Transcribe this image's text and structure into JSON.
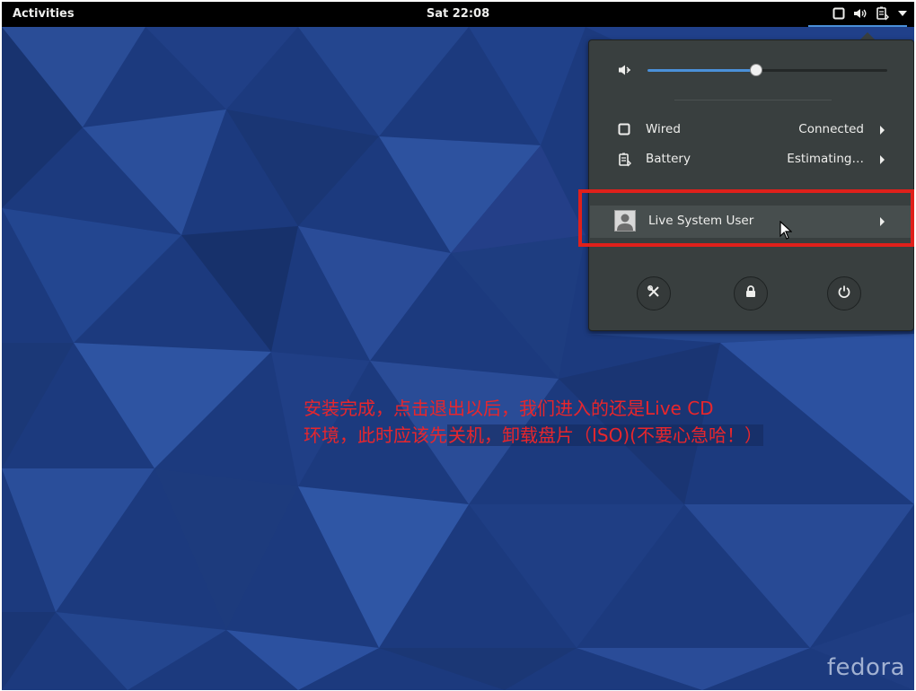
{
  "topbar": {
    "activities": "Activities",
    "clock": "Sat 22:08",
    "tray_icons": [
      "network-wired-icon",
      "speaker-icon",
      "battery-icon",
      "menu-arrow-down-icon"
    ]
  },
  "menu": {
    "volume": {
      "icon": "speaker-muted-icon",
      "level": 0.45
    },
    "wired": {
      "label": "Wired",
      "value": "Connected",
      "icon": "network-wired-icon"
    },
    "battery": {
      "label": "Battery",
      "value": "Estimating…",
      "icon": "battery-icon"
    },
    "user": {
      "label": "Live System User",
      "icon": "avatar-icon"
    },
    "actions": [
      "settings-icon",
      "lock-icon",
      "power-icon"
    ]
  },
  "annotation": {
    "line1": "安装完成，点击退出以后，我们进入的还是Live CD",
    "line2_prefix": "环境，此时应该先",
    "line2_highlight": "关机，卸载盘片（ISO)(不要心急哈！）"
  },
  "branding": {
    "logo": "fedora"
  },
  "colors": {
    "accent": "#4a90d9",
    "highlight_box": "#e0201b",
    "annotation_text": "#e8262c",
    "panel": "#393f3f"
  }
}
